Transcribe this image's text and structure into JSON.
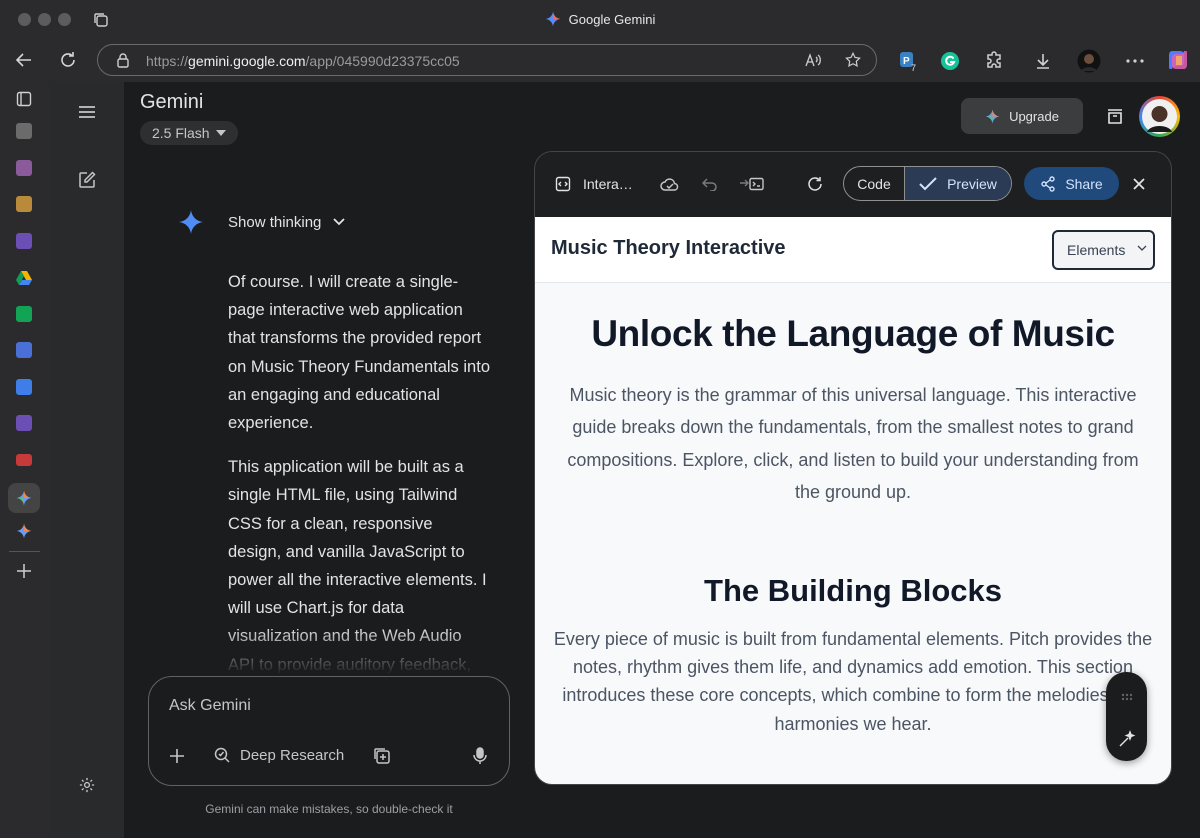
{
  "window": {
    "title": "Google Gemini"
  },
  "address_bar": {
    "url_prefix": "https://",
    "url_host": "gemini.google.com",
    "url_path": "/app/045990d23375cc05"
  },
  "extensions": {
    "badge_count": "7"
  },
  "app": {
    "name": "Gemini",
    "model": "2.5 Flash",
    "upgrade_label": "Upgrade"
  },
  "chat": {
    "show_thinking": "Show thinking",
    "paragraphs": [
      "Of course. I will create a single-page interactive web application that transforms the provided report on Music Theory Fundamentals into an engaging and educational experience.",
      "This application will be built as a single HTML file, using Tailwind CSS for a clean, responsive design, and vanilla JavaScript to power all the interactive elements. I will use Chart.js for data visualization and the Web Audio API to provide auditory feedback,"
    ]
  },
  "composer": {
    "placeholder": "Ask Gemini",
    "deep_research": "Deep Research"
  },
  "disclaimer": "Gemini can make mistakes, so double-check it",
  "canvas": {
    "title": "Intera…",
    "code_label": "Code",
    "preview_label": "Preview",
    "share_label": "Share"
  },
  "preview": {
    "brand": "Music Theory Interactive",
    "select_value": "Elements",
    "hero_title": "Unlock the Language of Music",
    "hero_text": "Music theory is the grammar of this universal language. This interactive guide breaks down the fundamentals, from the smallest notes to grand compositions. Explore, click, and listen to build your understanding from the ground up.",
    "section_title": "The Building Blocks",
    "section_text": "Every piece of music is built from fundamental elements. Pitch provides the notes, rhythm gives them life, and dynamics add emotion. This section introduces these core concepts, which combine to form the melodies and harmonies we hear."
  },
  "colors": {
    "accent": "#1f4a7b",
    "preview_bg": "#f8f9fb",
    "app_bg": "#1b1c1d"
  }
}
